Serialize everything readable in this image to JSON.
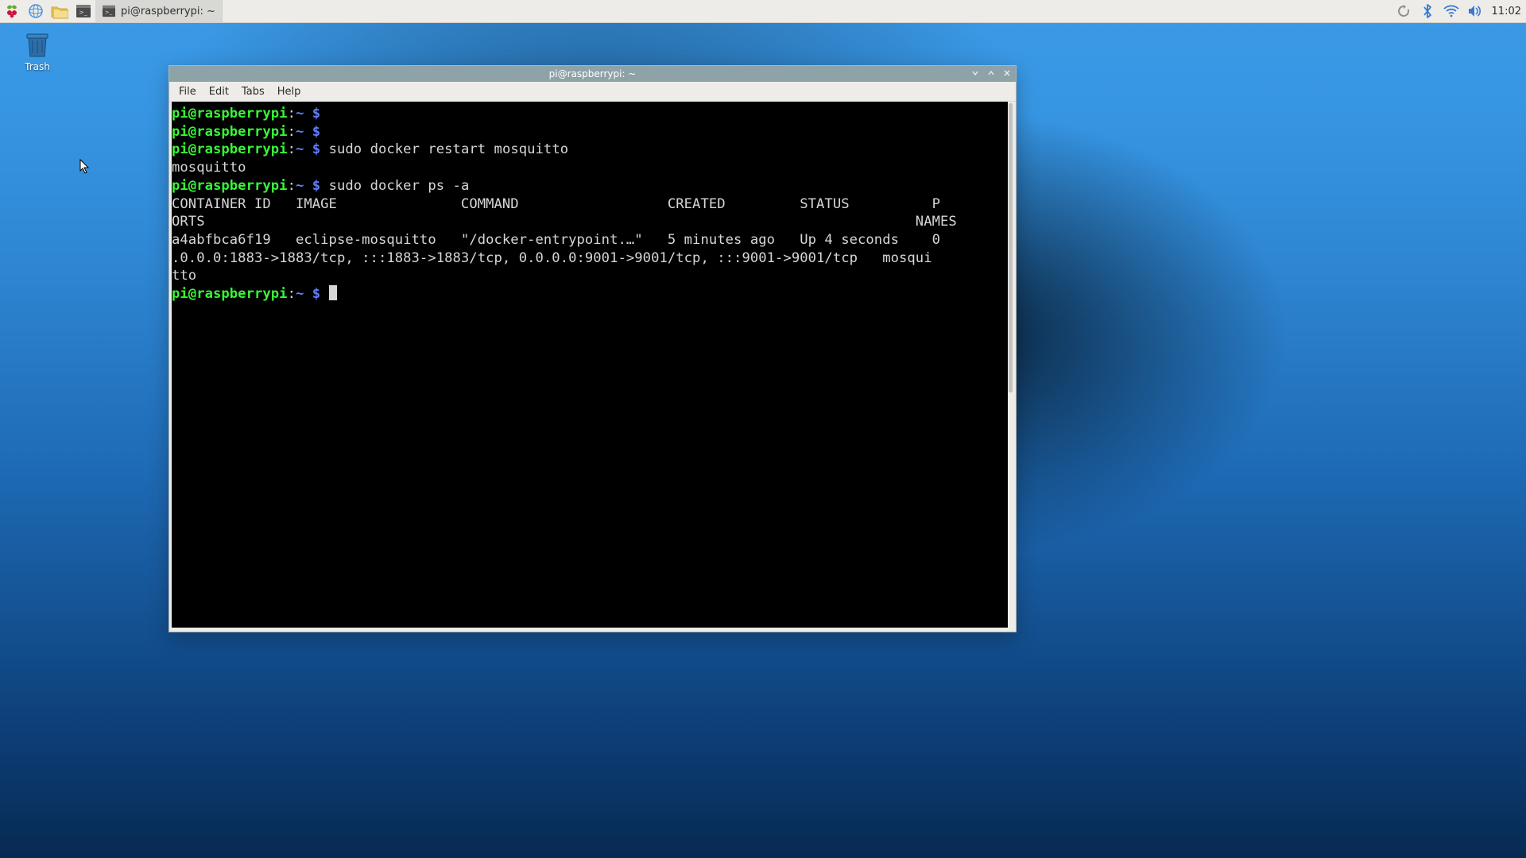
{
  "taskbar": {
    "task_label": "pi@raspberrypi: ~",
    "clock": "11:02"
  },
  "desktop": {
    "trash_label": "Trash"
  },
  "window": {
    "title": "pi@raspberrypi: ~",
    "menu": {
      "file": "File",
      "edit": "Edit",
      "tabs": "Tabs",
      "help": "Help"
    }
  },
  "terminal": {
    "prompt_user": "pi@raspberrypi",
    "prompt_path": "~",
    "lines": [
      {
        "t": "prompt",
        "cmd": ""
      },
      {
        "t": "prompt",
        "cmd": ""
      },
      {
        "t": "prompt",
        "cmd": "sudo docker restart mosquitto"
      },
      {
        "t": "out",
        "text": "mosquitto"
      },
      {
        "t": "prompt",
        "cmd": "sudo docker ps -a"
      },
      {
        "t": "out",
        "text": "CONTAINER ID   IMAGE               COMMAND                  CREATED         STATUS          P"
      },
      {
        "t": "out",
        "text": "ORTS                                                                                      NAMES"
      },
      {
        "t": "out",
        "text": "a4abfbca6f19   eclipse-mosquitto   \"/docker-entrypoint.…\"   5 minutes ago   Up 4 seconds    0"
      },
      {
        "t": "out",
        "text": ".0.0.0:1883->1883/tcp, :::1883->1883/tcp, 0.0.0.0:9001->9001/tcp, :::9001->9001/tcp   mosqui"
      },
      {
        "t": "out",
        "text": "tto"
      },
      {
        "t": "prompt-cursor",
        "cmd": ""
      }
    ]
  }
}
